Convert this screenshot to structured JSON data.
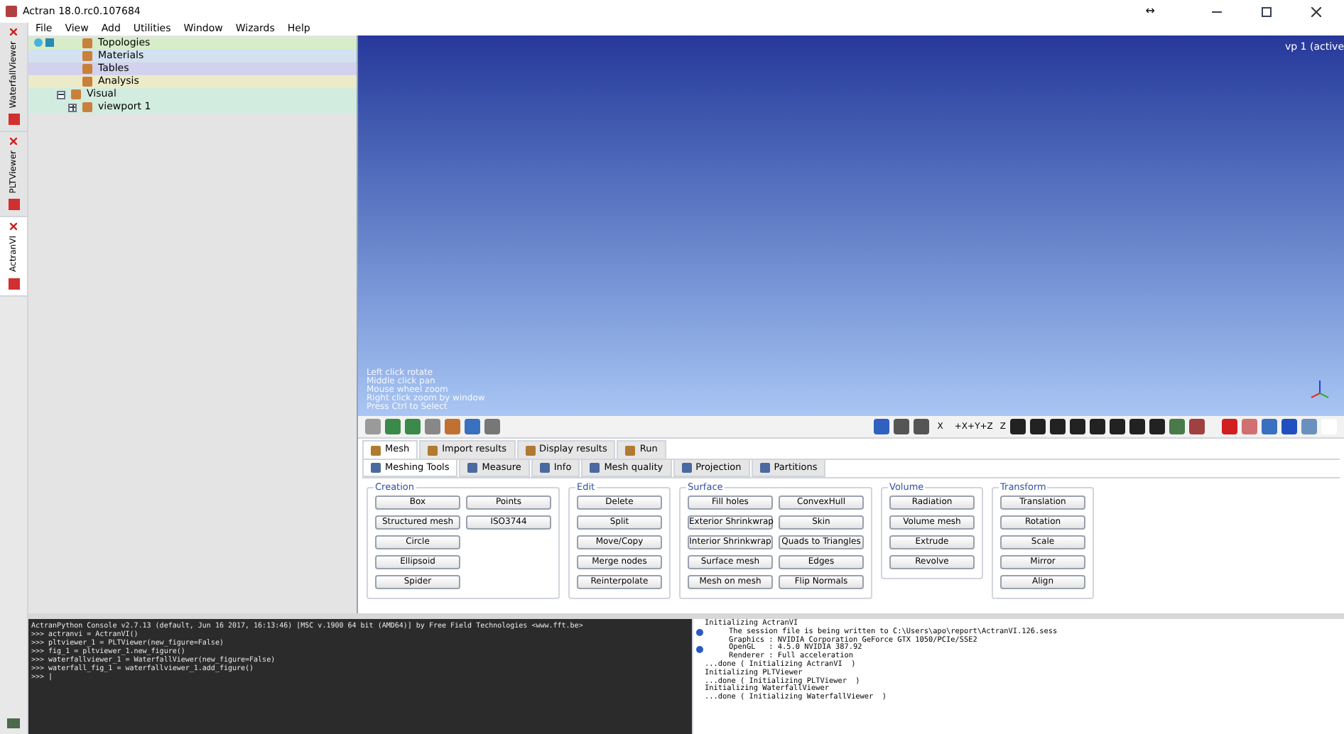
{
  "window": {
    "title": "Actran 18.0.rc0.107684",
    "resize_glyph": "↔"
  },
  "side_tabs": [
    {
      "label": "WaterfallViewer",
      "selected": false
    },
    {
      "label": "PLTViewer",
      "selected": false
    },
    {
      "label": "ActranVI",
      "selected": true
    }
  ],
  "menu": [
    "File",
    "View",
    "Add",
    "Utilities",
    "Window",
    "Wizards",
    "Help"
  ],
  "tree": [
    {
      "label": "Topologies",
      "color": "#d7ecc9"
    },
    {
      "label": "Materials",
      "color": "#d3e2ee"
    },
    {
      "label": "Tables",
      "color": "#d2d2ee"
    },
    {
      "label": "Analysis",
      "color": "#ecebc9"
    },
    {
      "label": "Visual",
      "color": "#d3ece0",
      "expanded": true,
      "children": [
        {
          "label": "viewport 1",
          "color": "#d3ece0",
          "expanded": false
        }
      ]
    }
  ],
  "viewport": {
    "label": "vp 1 (active",
    "hints": [
      "Left click rotate",
      "Middle click pan",
      "Mouse wheel zoom",
      "Right click zoom by window",
      "Press Ctrl to Select"
    ]
  },
  "toolbar_labels": [
    "X",
    "+X+Y+Z",
    "Z"
  ],
  "main_tabs": [
    {
      "label": "Mesh",
      "selected": true
    },
    {
      "label": "Import results",
      "selected": false
    },
    {
      "label": "Display results",
      "selected": false
    },
    {
      "label": "Run",
      "selected": false
    }
  ],
  "sub_tabs": [
    {
      "label": "Meshing Tools",
      "selected": true
    },
    {
      "label": "Measure",
      "selected": false
    },
    {
      "label": "Info",
      "selected": false
    },
    {
      "label": "Mesh quality",
      "selected": false
    },
    {
      "label": "Projection",
      "selected": false
    },
    {
      "label": "Partitions",
      "selected": false
    }
  ],
  "groups": [
    {
      "title": "Creation",
      "columns": [
        [
          "Box",
          "Structured mesh",
          "Circle",
          "Ellipsoid",
          "Spider"
        ],
        [
          "Points",
          "ISO3744"
        ]
      ]
    },
    {
      "title": "Edit",
      "columns": [
        [
          "Delete",
          "Split",
          "Move/Copy",
          "Merge nodes",
          "Reinterpolate"
        ]
      ]
    },
    {
      "title": "Surface",
      "columns": [
        [
          "Fill holes",
          "Exterior Shrinkwrap",
          "Interior Shrinkwrap",
          "Surface mesh",
          "Mesh on mesh"
        ],
        [
          "ConvexHull",
          "Skin",
          "Quads to Triangles",
          "Edges",
          "Flip Normals"
        ]
      ]
    },
    {
      "title": "Volume",
      "columns": [
        [
          "Radiation",
          "Volume mesh",
          "Extrude",
          "Revolve"
        ]
      ]
    },
    {
      "title": "Transform",
      "columns": [
        [
          "Translation",
          "Rotation",
          "Scale",
          "Mirror",
          "Align"
        ]
      ]
    }
  ],
  "console": [
    "ActranPython Console v2.7.13 (default, Jun 16 2017, 16:13:46) [MSC v.1900 64 bit (AMD64)] by Free Field Technologies <www.fft.be>",
    ">>> actranvi = ActranVI()",
    ">>> pltviewer_1 = PLTViewer(new_figure=False)",
    ">>> fig_1 = pltviewer_1.new_figure()",
    ">>> waterfallviewer_1 = WaterfallViewer(new_figure=False)",
    ">>> waterfall_fig_1 = waterfallviewer_1.add_figure()",
    ">>> |"
  ],
  "log": [
    {
      "text": "Initializing ActranVI",
      "kind": "plain",
      "info": false
    },
    {
      "text": "The session file is being written to C:\\Users\\apo\\report\\ActranVI.126.sess",
      "kind": "detail",
      "info": true
    },
    {
      "text": "Graphics : NVIDIA Corporation GeForce GTX 1050/PCIe/SSE2",
      "kind": "detail",
      "info": false
    },
    {
      "text": "OpenGL   : 4.5.0 NVIDIA 387.92",
      "kind": "detail",
      "info": true
    },
    {
      "text": "Renderer : Full acceleration",
      "kind": "detail",
      "info": false
    },
    {
      "text": "...done ( Initializing ActranVI  )",
      "kind": "plain",
      "info": false
    },
    {
      "text": "Initializing PLTViewer",
      "kind": "plain",
      "info": false
    },
    {
      "text": "...done ( Initializing PLTViewer  )",
      "kind": "plain",
      "info": false
    },
    {
      "text": "Initializing WaterfallViewer",
      "kind": "plain",
      "info": false
    },
    {
      "text": "...done ( Initializing WaterfallViewer  )",
      "kind": "plain",
      "info": false
    }
  ]
}
